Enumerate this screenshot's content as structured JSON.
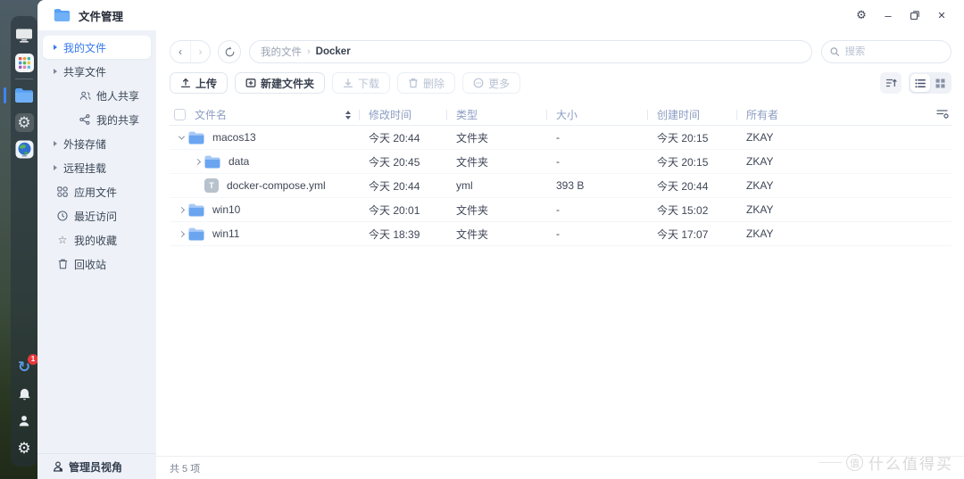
{
  "window": {
    "title": "文件管理"
  },
  "icons": {
    "gear": "⚙",
    "sync": "↻",
    "star": "☆",
    "back": "‹",
    "forward": "›",
    "minimize": "–",
    "close": "✕",
    "more_dots": "⋯"
  },
  "dock": {
    "sync_badge": "1"
  },
  "sidebar": {
    "items": [
      {
        "label": "我的文件",
        "active": true
      },
      {
        "label": "共享文件",
        "active": false
      },
      {
        "label": "他人共享",
        "active": false
      },
      {
        "label": "我的共享",
        "active": false
      },
      {
        "label": "外接存储",
        "active": false
      },
      {
        "label": "远程挂载",
        "active": false
      },
      {
        "label": "应用文件",
        "active": false
      },
      {
        "label": "最近访问",
        "active": false
      },
      {
        "label": "我的收藏",
        "active": false
      },
      {
        "label": "回收站",
        "active": false
      }
    ],
    "footer": {
      "label": "管理员视角"
    }
  },
  "pathbar": {
    "breadcrumb": {
      "root": "我的文件",
      "separator": "›",
      "current": "Docker"
    },
    "search_placeholder": "搜索"
  },
  "toolbar": {
    "buttons": [
      {
        "label": "上传",
        "enabled": true
      },
      {
        "label": "新建文件夹",
        "enabled": true
      },
      {
        "label": "下载",
        "enabled": false
      },
      {
        "label": "删除",
        "enabled": false
      },
      {
        "label": "更多",
        "enabled": false
      }
    ]
  },
  "table": {
    "headers": {
      "name": "文件名",
      "modified": "修改时间",
      "type": "类型",
      "size": "大小",
      "created": "创建时间",
      "owner": "所有者"
    },
    "rows": [
      {
        "name": "macos13",
        "indent": 0,
        "chevron": "down",
        "icon": "folder",
        "modified": "今天 20:44",
        "type": "文件夹",
        "size": "-",
        "created": "今天 20:15",
        "owner": "ZKAY"
      },
      {
        "name": "data",
        "indent": 1,
        "chevron": "right",
        "icon": "folder",
        "modified": "今天 20:45",
        "type": "文件夹",
        "size": "-",
        "created": "今天 20:15",
        "owner": "ZKAY"
      },
      {
        "name": "docker-compose.yml",
        "indent": 1,
        "chevron": "none",
        "icon": "file",
        "file_letter": "T",
        "modified": "今天 20:44",
        "type": "yml",
        "size": "393 B",
        "created": "今天 20:44",
        "owner": "ZKAY"
      },
      {
        "name": "win10",
        "indent": 0,
        "chevron": "right",
        "icon": "folder",
        "modified": "今天 20:01",
        "type": "文件夹",
        "size": "-",
        "created": "今天 15:02",
        "owner": "ZKAY"
      },
      {
        "name": "win11",
        "indent": 0,
        "chevron": "right",
        "icon": "folder",
        "modified": "今天 18:39",
        "type": "文件夹",
        "size": "-",
        "created": "今天 17:07",
        "owner": "ZKAY"
      }
    ]
  },
  "statusbar": {
    "count": "共 5 项"
  },
  "watermark": {
    "badge": "值",
    "text": "什么值得买"
  },
  "colors": {
    "accent": "#3577f0",
    "folder": "#6ba5f0",
    "header_text": "#8c9dc2",
    "disabled": "#b9c2d4"
  }
}
